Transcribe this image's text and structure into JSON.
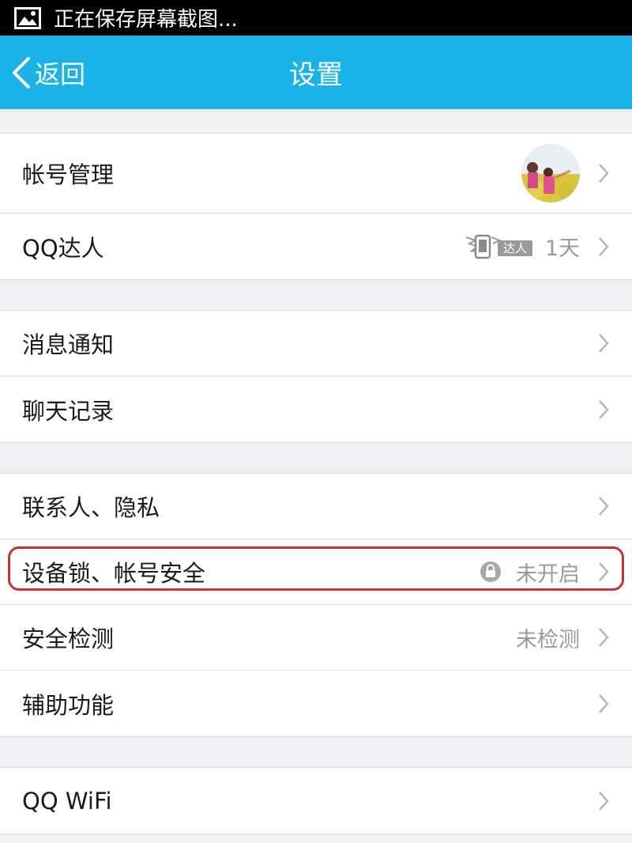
{
  "status_bar": {
    "notification": "正在保存屏幕截图...",
    "icon": "image-icon"
  },
  "header": {
    "back_label": "返回",
    "title": "设置",
    "background_color": "#19b3e8"
  },
  "groups": [
    {
      "items": [
        {
          "label": "帐号管理",
          "value": "",
          "accessory": "avatar"
        },
        {
          "label": "QQ达人",
          "value": "1天",
          "accessory": "qq-daren-badge",
          "badge_text": "达人"
        }
      ]
    },
    {
      "items": [
        {
          "label": "消息通知",
          "value": ""
        },
        {
          "label": "聊天记录",
          "value": ""
        }
      ]
    },
    {
      "items": [
        {
          "label": "联系人、隐私",
          "value": ""
        },
        {
          "label": "设备锁、帐号安全",
          "value": "未开启",
          "accessory": "lock-icon",
          "highlighted": true
        },
        {
          "label": "安全检测",
          "value": "未检测"
        },
        {
          "label": "辅助功能",
          "value": ""
        }
      ]
    },
    {
      "items": [
        {
          "label": "QQ WiFi",
          "value": ""
        }
      ]
    }
  ],
  "colors": {
    "highlight_border": "#c9303a",
    "value_text": "#9a9a9a",
    "page_background": "#efeff4"
  }
}
